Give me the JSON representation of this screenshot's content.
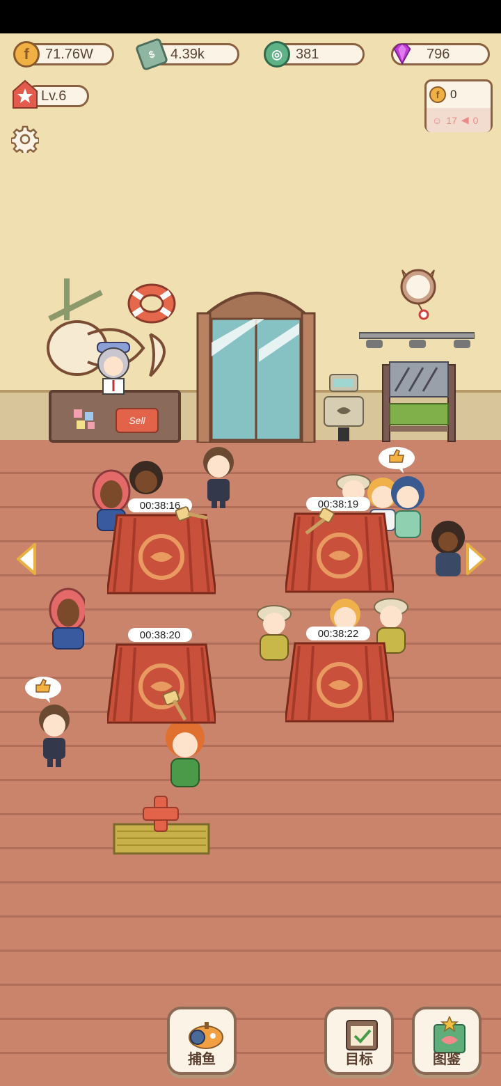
{
  "currencies": {
    "coins": "71.76W",
    "cash": "4.39k",
    "shells": "381",
    "gems": "796"
  },
  "level": "Lv.6",
  "income": {
    "coins": "0",
    "happy_count": "17",
    "angry_count": "0"
  },
  "shop": {
    "sell_sign": "Sell"
  },
  "stalls": [
    {
      "timer": "00:38:16"
    },
    {
      "timer": "00:38:19"
    },
    {
      "timer": "00:38:20"
    },
    {
      "timer": "00:38:22"
    }
  ],
  "bottom_menu": {
    "fishing": "捕鱼",
    "goals": "目标",
    "guide": "图鉴"
  },
  "colors": {
    "wall": "#f0dfb0",
    "floor": "#c9846b",
    "stall_cloth": "#c9503a",
    "button_bg": "#fbf4e6"
  },
  "icons": [
    "coin-icon",
    "cash-icon",
    "shell-icon",
    "gem-icon",
    "star-icon",
    "gear-icon",
    "happy-face-icon",
    "angry-icon",
    "left-arrow-icon",
    "right-arrow-icon",
    "plus-icon",
    "submarine-icon",
    "checklist-icon",
    "fish-book-icon"
  ]
}
